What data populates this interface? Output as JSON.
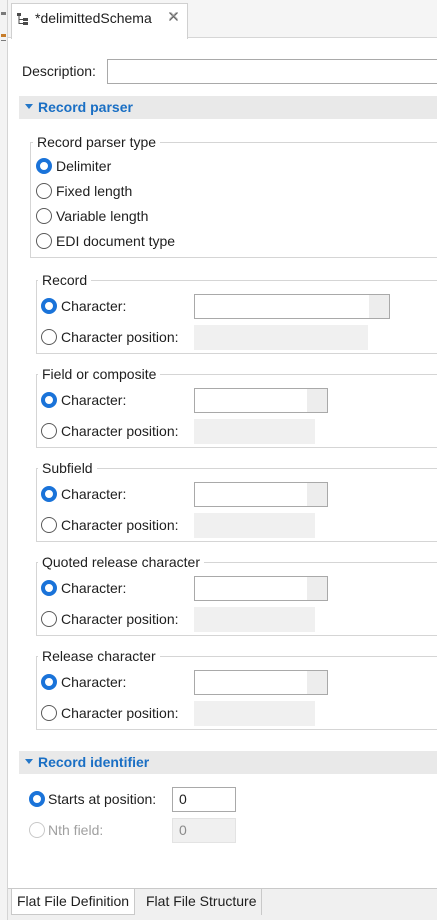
{
  "editor": {
    "tab_title": "*delimittedSchema",
    "tab_icon": "schema-tree-icon",
    "close_icon": "close-icon"
  },
  "description": {
    "label": "Description:",
    "value": ""
  },
  "record_parser": {
    "title": "Record parser",
    "type_group": {
      "title": "Record parser type",
      "options": [
        "Delimiter",
        "Fixed length",
        "Variable length",
        "EDI document type"
      ],
      "selected": "Delimiter"
    },
    "groups": [
      {
        "title": "Record",
        "character_label": "Character:",
        "position_label": "Character position:",
        "selected": "Character"
      },
      {
        "title": "Field or composite",
        "character_label": "Character:",
        "position_label": "Character position:",
        "selected": "Character"
      },
      {
        "title": "Subfield",
        "character_label": "Character:",
        "position_label": "Character position:",
        "selected": "Character"
      },
      {
        "title": "Quoted release character",
        "character_label": "Character:",
        "position_label": "Character position:",
        "selected": "Character"
      },
      {
        "title": "Release character",
        "character_label": "Character:",
        "position_label": "Character position:",
        "selected": "Character"
      }
    ]
  },
  "record_identifier": {
    "title": "Record identifier",
    "starts_label": "Starts at position:",
    "starts_value": "0",
    "nth_label": "Nth field:",
    "nth_value": "0",
    "selected": "Starts at position"
  },
  "bottom_tabs": [
    "Flat File Definition",
    "Flat File Structure"
  ],
  "active_bottom_tab": "Flat File Definition",
  "colors": {
    "accent": "#1a73d9",
    "section_title": "#1a6fc4",
    "section_bg": "#e9e9e9"
  }
}
